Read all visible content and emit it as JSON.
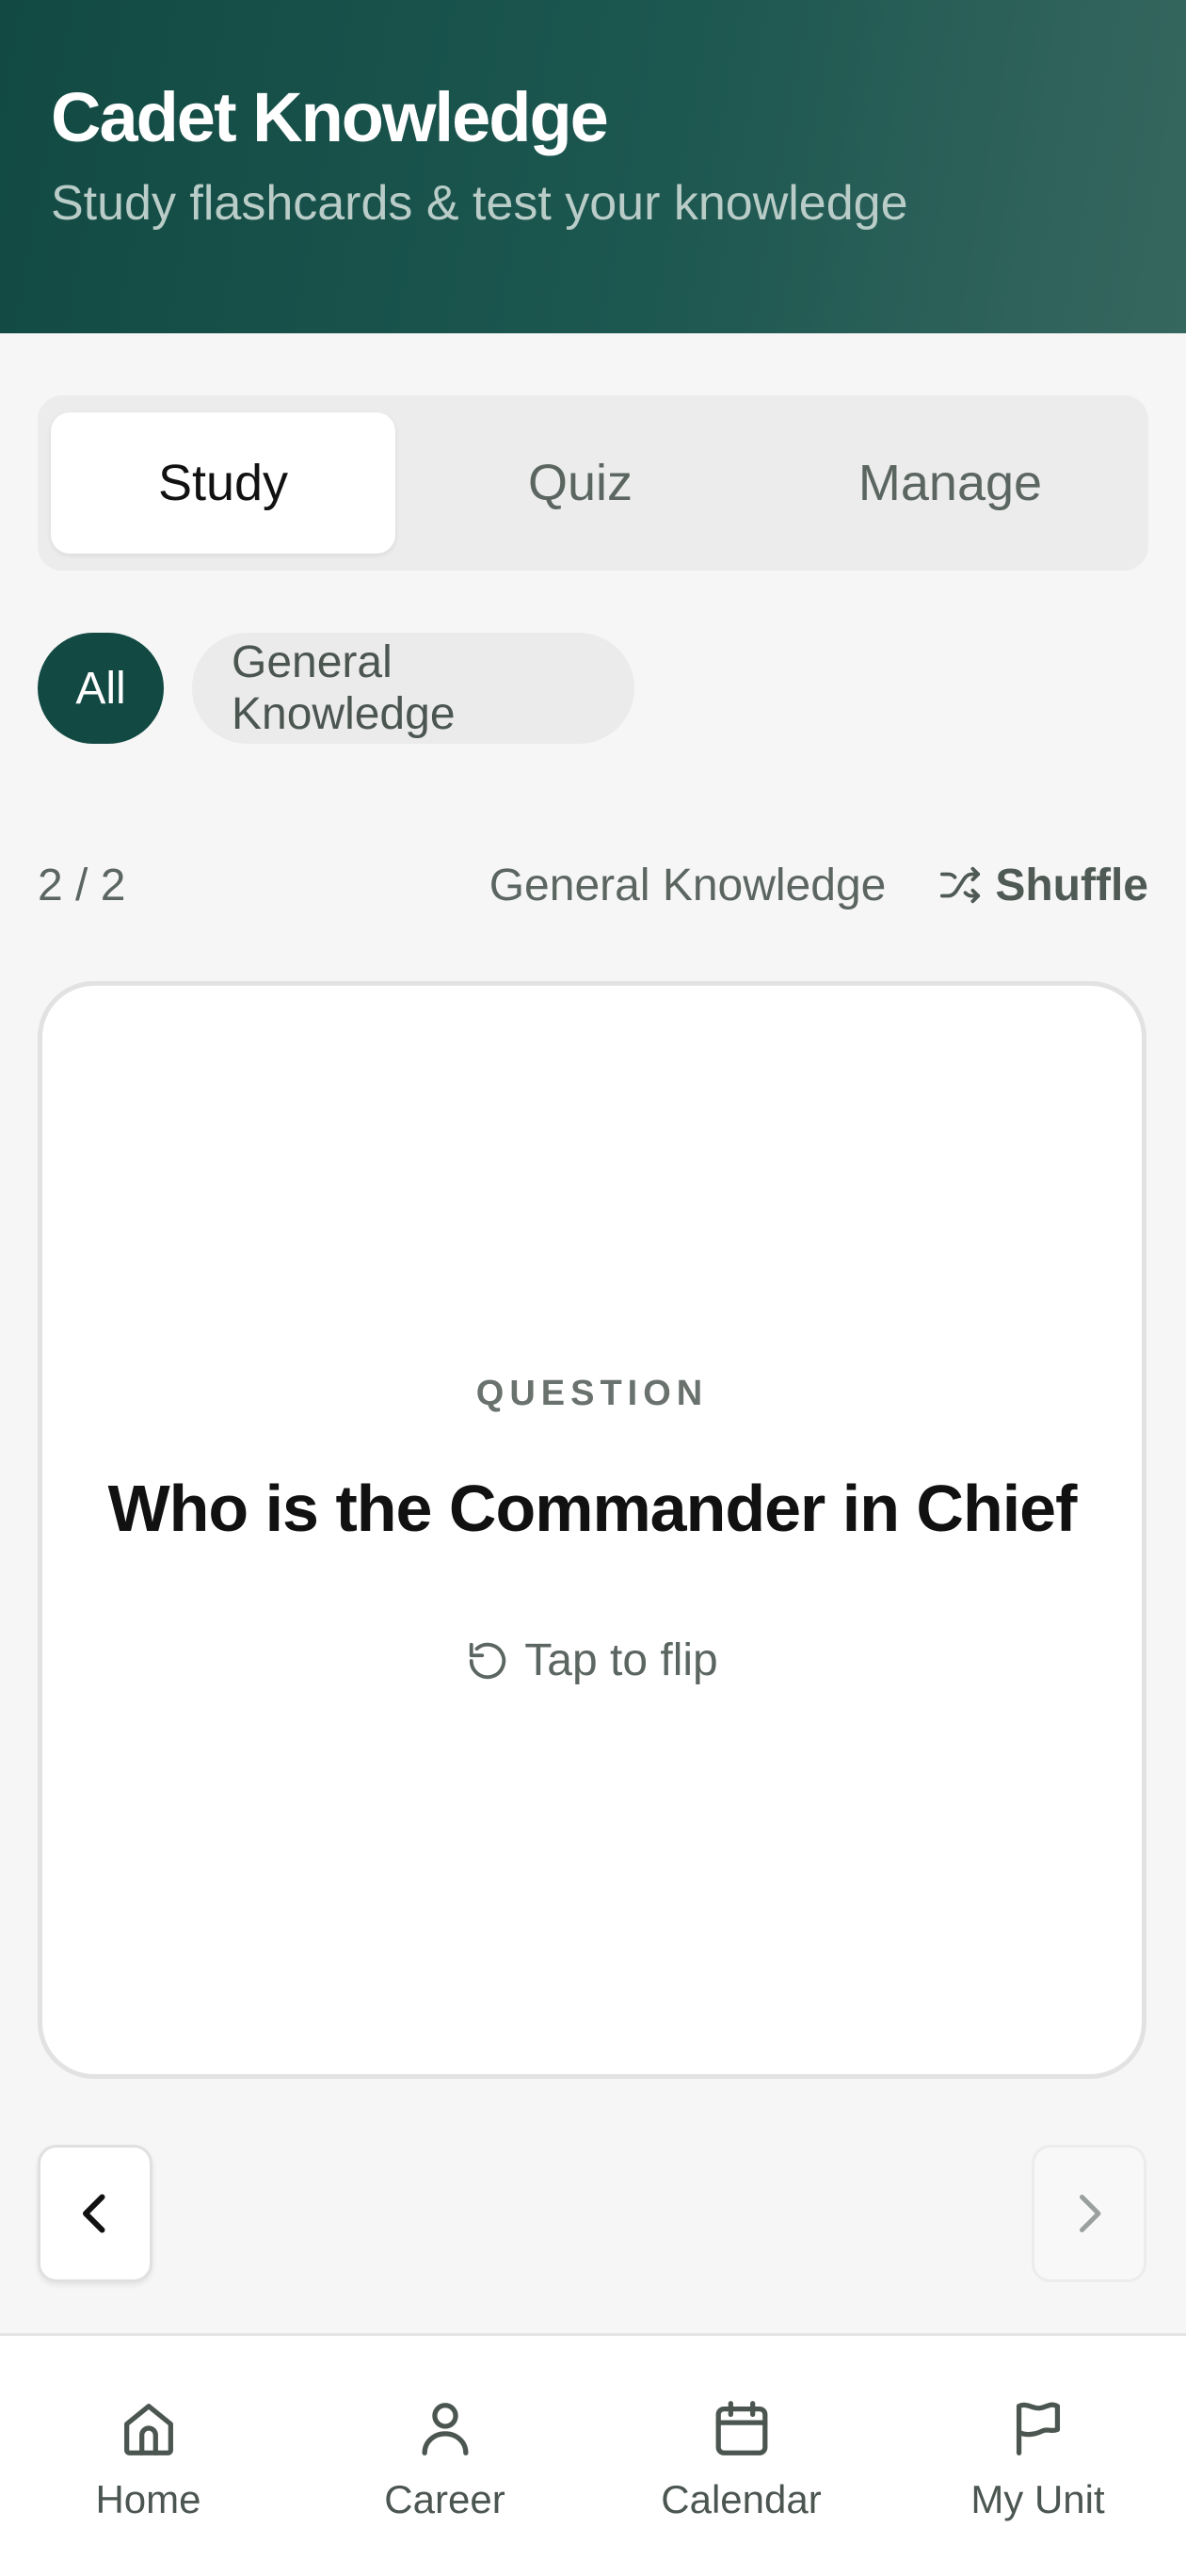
{
  "header": {
    "title": "Cadet Knowledge",
    "subtitle": "Study flashcards & test your knowledge"
  },
  "tabs": [
    {
      "label": "Study",
      "active": true
    },
    {
      "label": "Quiz",
      "active": false
    },
    {
      "label": "Manage",
      "active": false
    }
  ],
  "filters": [
    {
      "label": "All",
      "active": true
    },
    {
      "label": "General Knowledge",
      "active": false
    }
  ],
  "progress": {
    "counter": "2 / 2",
    "category": "General Knowledge",
    "shuffle_label": "Shuffle"
  },
  "card": {
    "side_label": "QUESTION",
    "text": "Who is the Commander in Chief",
    "flip_hint": "Tap to flip"
  },
  "bottom_nav": [
    {
      "label": "Home",
      "icon": "home-icon"
    },
    {
      "label": "Career",
      "icon": "person-icon"
    },
    {
      "label": "Calendar",
      "icon": "calendar-icon"
    },
    {
      "label": "My Unit",
      "icon": "flag-icon"
    }
  ],
  "colors": {
    "brand": "#124a43",
    "background": "#f6f6f6"
  }
}
